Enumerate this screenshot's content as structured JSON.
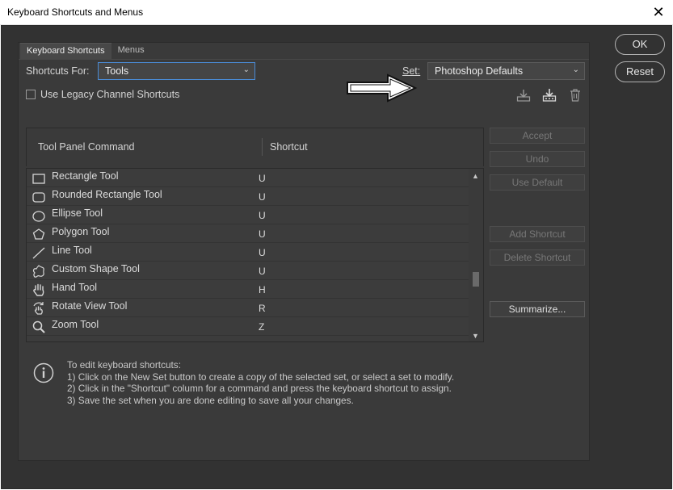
{
  "window": {
    "title": "Keyboard Shortcuts and Menus",
    "close_glyph": "✕"
  },
  "tabs": [
    {
      "label": "Keyboard Shortcuts",
      "active": true
    },
    {
      "label": "Menus",
      "active": false
    }
  ],
  "shortcuts_for": {
    "label": "Shortcuts For:",
    "value": "Tools"
  },
  "set": {
    "label": "Set:",
    "value": "Photoshop Defaults"
  },
  "legacy_checkbox": {
    "label": "Use Legacy Channel Shortcuts",
    "checked": false
  },
  "set_icons": [
    "save-set-icon",
    "save-as-set-icon",
    "delete-set-icon"
  ],
  "table": {
    "headers": {
      "command": "Tool Panel Command",
      "shortcut": "Shortcut"
    },
    "rows": [
      {
        "icon": "rectangle-icon",
        "name": "Rectangle Tool",
        "key": "U"
      },
      {
        "icon": "rounded-rectangle-icon",
        "name": "Rounded Rectangle Tool",
        "key": "U"
      },
      {
        "icon": "ellipse-icon",
        "name": "Ellipse Tool",
        "key": "U"
      },
      {
        "icon": "polygon-icon",
        "name": "Polygon Tool",
        "key": "U"
      },
      {
        "icon": "line-icon",
        "name": "Line Tool",
        "key": "U"
      },
      {
        "icon": "custom-shape-icon",
        "name": "Custom Shape Tool",
        "key": "U"
      },
      {
        "icon": "hand-icon",
        "name": "Hand Tool",
        "key": "H"
      },
      {
        "icon": "rotate-view-icon",
        "name": "Rotate View Tool",
        "key": "R"
      },
      {
        "icon": "zoom-icon",
        "name": "Zoom Tool",
        "key": "Z"
      }
    ]
  },
  "side_buttons": {
    "accept": "Accept",
    "undo": "Undo",
    "use_default": "Use Default",
    "add_shortcut": "Add Shortcut",
    "delete_shortcut": "Delete Shortcut",
    "summarize": "Summarize..."
  },
  "info": {
    "icon": "info-icon",
    "lines": "To edit keyboard shortcuts:\n1) Click on the New Set button to create a copy of the selected set, or select a set to modify.\n2) Click in the \"Shortcut\" column for a command and press the keyboard shortcut to assign.\n3) Save the set when you are done editing to save all your changes."
  },
  "dialog_buttons": {
    "ok": "OK",
    "reset": "Reset"
  },
  "colors": {
    "background": "#323232",
    "panel": "#3a3a3a",
    "focus": "#4a8bd6"
  }
}
